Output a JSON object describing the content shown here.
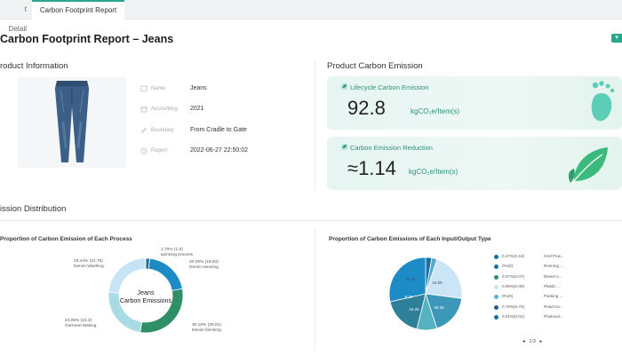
{
  "tabs": [
    {
      "label": "t Detail"
    },
    {
      "label": "Carbon Footprint Report"
    }
  ],
  "page_title": "Carbon Footprint Report – Jeans",
  "product_info": {
    "heading": "roduct Information",
    "fields": [
      {
        "label": "Name",
        "value": "Jeans",
        "icon": "tag-icon"
      },
      {
        "label": "Accounting",
        "value": "2021",
        "icon": "calendar-icon"
      },
      {
        "label": "Boundary",
        "value": "From Cradle to Gate",
        "icon": "pen-icon"
      },
      {
        "label": "Report",
        "value": "2022-06-27 22:50:02",
        "icon": "clock-icon"
      }
    ]
  },
  "emission": {
    "heading": "Product Carbon Emission",
    "lifecycle": {
      "label": "Lifecycle Carbon Emission",
      "value": "92.8",
      "unit": "kgCO₂e/Item(s)"
    },
    "reduction": {
      "label": "Carbon Emission Reduction",
      "value": "≈1.14",
      "unit": "kgCO₂e/Item(s)"
    }
  },
  "distribution_heading": "ission Distribution",
  "process_chart": {
    "title": "Proportion of Carbon Emission of Each Process",
    "center_line1": "Jeans",
    "center_line2": "Carbon Emissions",
    "labels": [
      {
        "line1": "1.70% (1.6)",
        "line2": "spinning process"
      },
      {
        "line1": "20.29% (18.83)",
        "line2": "Denim weaving"
      },
      {
        "line1": "30.18% (28.01)",
        "line2": "Denim finishing"
      },
      {
        "line1": "24.05% (22.3)",
        "line2": "Garment Making"
      },
      {
        "line1": "23.44% (21.76)",
        "line2": "Denim Washing"
      }
    ]
  },
  "io_chart": {
    "title": "Proportion of Carbon Emissions of Each Input/Output Type",
    "slice_labels": [
      "20.34",
      "16.55",
      "8.23",
      "16.25",
      "26.35"
    ],
    "legend": [
      {
        "pct": "0.47%(0.16)",
        "name": "Grid Pow..."
      },
      {
        "pct": "0%(0)",
        "name": "Running ..."
      },
      {
        "pct": "0.07%(0.07)",
        "name": "Diesel o..."
      },
      {
        "pct": "0.05%(0.05)",
        "name": "Plastic ..."
      },
      {
        "pct": "0%(0)",
        "name": "Packing ..."
      },
      {
        "pct": "0.76%(0.70)",
        "name": "Road tra..."
      },
      {
        "pct": "0.01%(0.01)",
        "name": "Photovol..."
      }
    ],
    "pager": "1/3"
  },
  "chart_data": [
    {
      "type": "pie",
      "title": "Proportion of Carbon Emission of Each Process",
      "categories": [
        "spinning process",
        "Denim weaving",
        "Denim finishing",
        "Garment Making",
        "Denim Washing"
      ],
      "values": [
        1.6,
        18.83,
        28.01,
        22.3,
        21.76
      ],
      "percent": [
        1.7,
        20.29,
        30.18,
        24.05,
        23.44
      ],
      "colors": [
        "#1f6f9f",
        "#1c8bc6",
        "#2f8f66",
        "#a8dbe4",
        "#c6e4f5"
      ]
    },
    {
      "type": "pie",
      "title": "Proportion of Carbon Emissions of Each Input/Output Type",
      "values": [
        2.5,
        2.2,
        20.34,
        16.55,
        8.23,
        16.25,
        26.35
      ],
      "colors": [
        "#1b6fa8",
        "#5aa7c7",
        "#cce5f6",
        "#3d97b8",
        "#56b2c0",
        "#2e7f9a",
        "#1c8bc6"
      ]
    }
  ]
}
